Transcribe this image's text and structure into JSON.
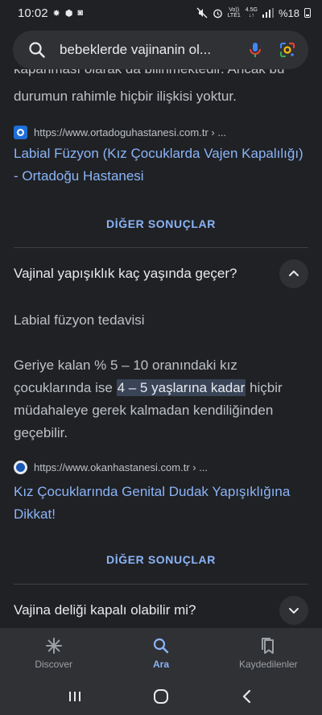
{
  "status_bar": {
    "time": "10:02",
    "left_icons": [
      "sun-icon",
      "cube-icon",
      "camera-icon"
    ],
    "right_icons": [
      "mute-icon",
      "alarm-icon"
    ],
    "volte": "Vo))",
    "lte": "LTE1",
    "net": "4.5G",
    "battery": "%18"
  },
  "search": {
    "query": "bebeklerde vajinanin ol..."
  },
  "results": {
    "prev_text_cut": "kapanması olarak da bilinmektedir. Ancak bu",
    "prev_text_last": "durumun rahimle hiçbir ilişkisi yoktur.",
    "source1_url": "https://www.ortadoguhastanesi.com.tr › ...",
    "link1": "Labial Füzyon (Kız Çocuklarda Vajen Kapalılığı) - Ortadoğu Hastanesi",
    "more1": "DİĞER SONUÇLAR",
    "question1": "Vajinal yapışıklık kaç yaşında geçer?",
    "answer_heading": "Labial füzyon tedavisi",
    "answer_before": "Geriye kalan % 5 – 10 oranındaki kız çocuklarında ise ",
    "answer_highlight": "4 – 5 yaşlarına kadar",
    "answer_after": " hiçbir müdahaleye gerek kalmadan kendiliğinden geçebilir.",
    "source2_url": "https://www.okanhastanesi.com.tr › ...",
    "link2": "Kız Çocuklarında Genital Dudak Yapışıklığına Dikkat!",
    "more2": "DİĞER SONUÇLAR",
    "question2": "Vajina deliği kapalı olabilir mi?"
  },
  "bottom_nav": {
    "items": [
      {
        "label": "Discover",
        "icon": "asterisk-icon",
        "active": false
      },
      {
        "label": "Ara",
        "icon": "search-icon",
        "active": true
      },
      {
        "label": "Kaydedilenler",
        "icon": "bookmarks-icon",
        "active": false
      }
    ]
  },
  "colors": {
    "background": "#202124",
    "surface": "#303134",
    "link": "#8ab4f8",
    "text": "#e8eaed",
    "secondary_text": "#bdc1c6"
  }
}
